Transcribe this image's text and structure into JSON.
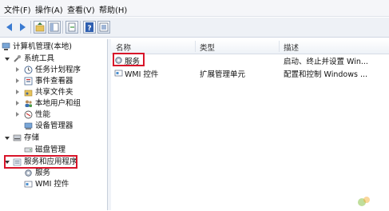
{
  "menu": [
    "文件(F)",
    "操作(A)",
    "查看(V)",
    "帮助(H)"
  ],
  "toolbar": {
    "icons": [
      "back-arrow-icon",
      "forward-arrow-icon",
      "up-folder-icon",
      "show-tree-icon",
      "export-list-icon",
      "help-icon",
      "properties-icon"
    ]
  },
  "tree": {
    "root": "计算机管理(本地)",
    "system_tools": "系统工具",
    "task_scheduler": "任务计划程序",
    "event_viewer": "事件查看器",
    "shared_folders": "共享文件夹",
    "local_users": "本地用户和组",
    "performance": "性能",
    "device_manager": "设备管理器",
    "storage": "存储",
    "disk_management": "磁盘管理",
    "services_apps": "服务和应用程序",
    "services": "服务",
    "wmi": "WMI 控件"
  },
  "list": {
    "columns": [
      "名称",
      "类型",
      "描述"
    ],
    "rows": [
      {
        "name": "服务",
        "type": "",
        "desc": "启动、终止并设置 Win..."
      },
      {
        "name": "WMI 控件",
        "type": "扩展管理单元",
        "desc": "配置和控制 Windows ..."
      }
    ]
  },
  "colors": {
    "highlight": "#d8152a",
    "toolbar_bg": "#eef1f6"
  }
}
